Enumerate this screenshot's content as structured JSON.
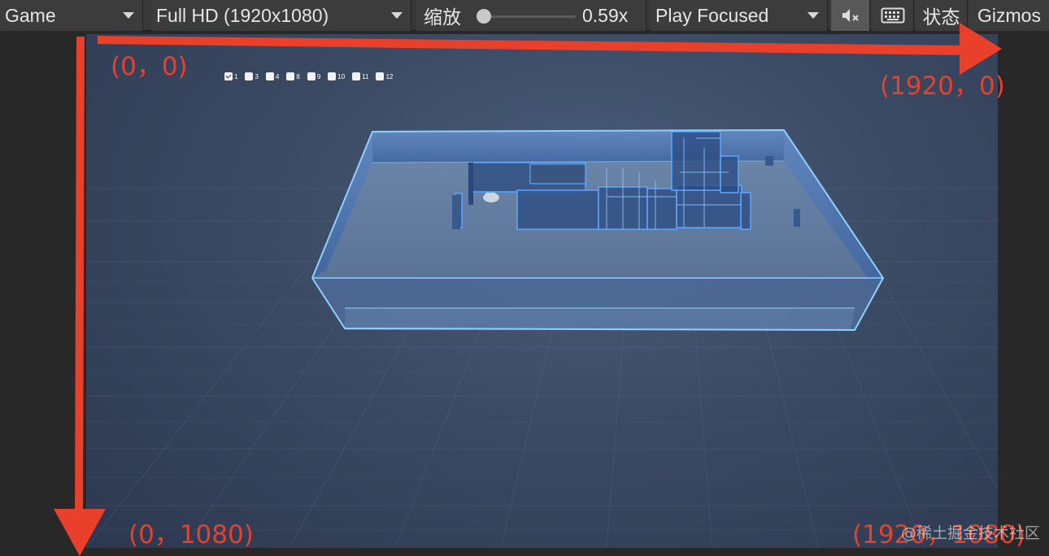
{
  "toolbar": {
    "view_dropdown": "Game",
    "resolution_dropdown": "Full HD (1920x1080)",
    "scale_label": "缩放",
    "scale_value": "0.59x",
    "scale_level": 0.59,
    "play_mode_dropdown": "Play Focused",
    "mute_icon": "audio-mute-icon",
    "keyboard_icon": "keyboard-icon",
    "stats_button": "状态",
    "gizmos_button": "Gizmos"
  },
  "layer_toggles": [
    {
      "label": "1",
      "checked": true
    },
    {
      "label": "3",
      "checked": false
    },
    {
      "label": "4",
      "checked": false
    },
    {
      "label": "8",
      "checked": false
    },
    {
      "label": "9",
      "checked": false
    },
    {
      "label": "10",
      "checked": false
    },
    {
      "label": "11",
      "checked": false
    },
    {
      "label": "12",
      "checked": false
    }
  ],
  "annotations": {
    "top_left": "(0，0)",
    "top_right": "(1920，0)",
    "bottom_left": "(0，1080)",
    "bottom_right": "(1920，1080)",
    "color": "#e8402a"
  },
  "watermark": "@稀土掘金技术社区"
}
